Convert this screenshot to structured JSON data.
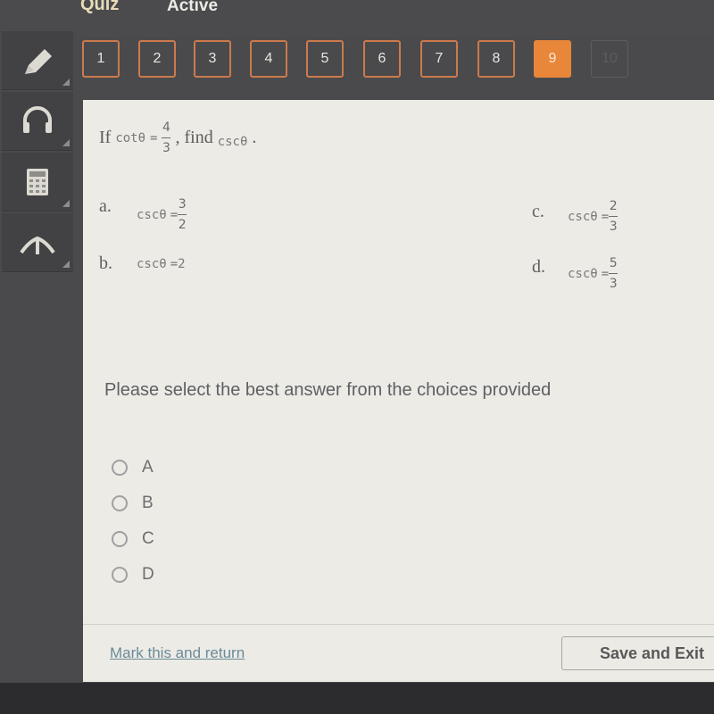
{
  "header": {
    "title": "Quiz",
    "status": "Active"
  },
  "question_nav": {
    "items": [
      {
        "label": "1",
        "state": "answered"
      },
      {
        "label": "2",
        "state": "answered"
      },
      {
        "label": "3",
        "state": "answered"
      },
      {
        "label": "4",
        "state": "answered"
      },
      {
        "label": "5",
        "state": "answered"
      },
      {
        "label": "6",
        "state": "answered"
      },
      {
        "label": "7",
        "state": "answered"
      },
      {
        "label": "8",
        "state": "answered"
      },
      {
        "label": "9",
        "state": "current"
      },
      {
        "label": "10",
        "state": "disabled"
      }
    ],
    "current_color": "#e8863a",
    "border_color": "#cc7a4c"
  },
  "tools": [
    {
      "name": "pencil-icon"
    },
    {
      "name": "headphones-icon"
    },
    {
      "name": "calculator-icon"
    },
    {
      "name": "reference-icon"
    }
  ],
  "question": {
    "prefix": "If",
    "given_fn": "cotθ",
    "equals": "=",
    "given_num": "4",
    "given_den": "3",
    "mid": ", find",
    "target_fn": "cscθ",
    "suffix": "."
  },
  "choices": [
    {
      "letter": "a.",
      "fn": "cscθ",
      "eq": "=",
      "num": "3",
      "den": "2"
    },
    {
      "letter": "b.",
      "fn": "cscθ",
      "eq": "=",
      "value": "2"
    },
    {
      "letter": "c.",
      "fn": "cscθ",
      "eq": "=",
      "num": "2",
      "den": "3"
    },
    {
      "letter": "d.",
      "fn": "cscθ",
      "eq": "=",
      "num": "5",
      "den": "3"
    }
  ],
  "instruction": "Please select the best answer from the choices provided",
  "options": [
    {
      "label": "A",
      "selected": false
    },
    {
      "label": "B",
      "selected": false
    },
    {
      "label": "C",
      "selected": false
    },
    {
      "label": "D",
      "selected": false
    }
  ],
  "footer": {
    "mark_link": "Mark this and return",
    "save_button": "Save and Exit"
  }
}
